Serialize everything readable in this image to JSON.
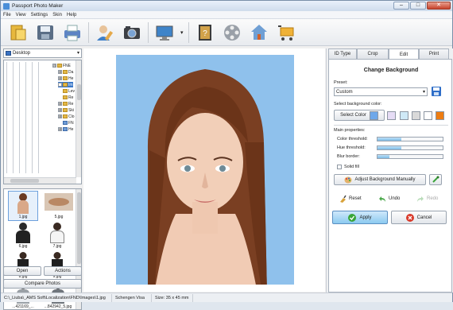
{
  "window": {
    "title": "Passport Photo Maker",
    "min": "–",
    "max": "□",
    "close": "✕"
  },
  "menu": [
    "File",
    "View",
    "Settings",
    "Skin",
    "Help"
  ],
  "toolbar": {
    "items": [
      "open-folder",
      "save",
      "print",
      "edit-user",
      "camera",
      "monitor",
      "dropdown-arrow",
      "help-book",
      "film-reel",
      "house",
      "cart"
    ],
    "dropdown_glyph": "▾"
  },
  "left": {
    "drive": "Desktop",
    "drive_arrow": "▾",
    "tree": [
      {
        "label": "FNE",
        "pm": "⊟"
      },
      {
        "label": "Da",
        "pm": "⊞"
      },
      {
        "label": "He",
        "pm": "⊞"
      },
      {
        "label": "Im",
        "pm": "⊞"
      },
      {
        "label": "Lev",
        "pm": ""
      },
      {
        "label": "Re",
        "pm": ""
      },
      {
        "label": "Re",
        "pm": "⊞"
      },
      {
        "label": "Ski",
        "pm": "⊞"
      },
      {
        "label": "Clo",
        "pm": "⊞"
      },
      {
        "label": "FN",
        "pm": ""
      },
      {
        "label": "He",
        "pm": "⊞"
      }
    ],
    "thumbs": [
      "1.jpg",
      "5.jpg",
      "6.jpg",
      "7.jpg",
      "8.jpg",
      "9.jpg",
      "...421169_...",
      "...842942_5.jpg"
    ],
    "open": "Open",
    "actions": "Actions",
    "compare": "Compare Photos"
  },
  "right": {
    "tabs": [
      "ID Type",
      "Crop",
      "Edit",
      "Print"
    ],
    "active_tab": "Edit",
    "title": "Change Background",
    "preset_label": "Preset:",
    "preset_value": "Custom",
    "preset_arrow": "▾",
    "bg_label": "Select background color:",
    "select_color": "Select Color",
    "swatches": [
      "#e6dcf5",
      "#cfe9f7",
      "#d9d9d9",
      "#ffffff",
      "#ee7d12"
    ],
    "current_color": "#6ea8ea",
    "main_props": "Main properties:",
    "props": [
      {
        "label": "Color threshold:",
        "value": 0.37
      },
      {
        "label": "Hue threshold:",
        "value": 0.37
      },
      {
        "label": "Blur border:",
        "value": 0.18
      }
    ],
    "solid_fill": "Solid fill",
    "adjust": "Adjust Background Manually",
    "reset": "Reset",
    "undo": "Undo",
    "redo": "Redo",
    "apply": "Apply",
    "cancel": "Cancel"
  },
  "status": {
    "path": "C:\\_Liuba\\_AMS Soft\\Localization\\FND\\Images\\1.jpg",
    "type": "Schengen Visa",
    "size": "Size: 35 x 45 mm"
  },
  "colors": {
    "accent": "#6ea8ea",
    "apply": "#8ccaf0",
    "cancel": "#f0f0f0",
    "photo_bg": "#8fc1ec"
  }
}
